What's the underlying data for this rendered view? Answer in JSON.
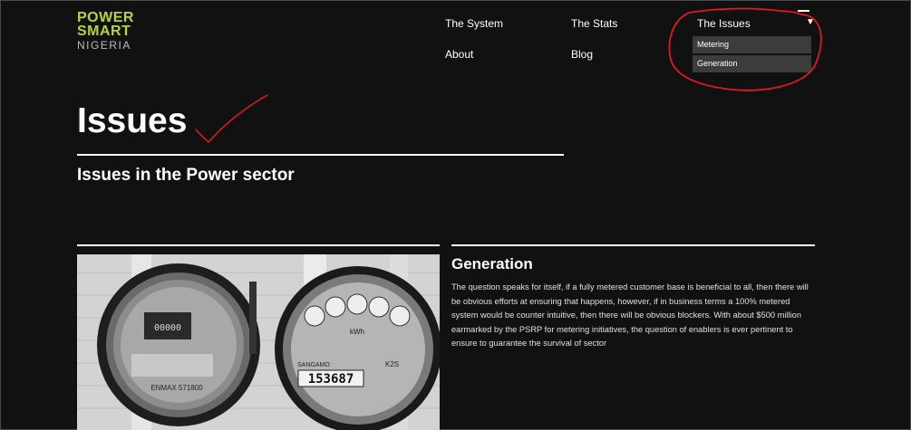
{
  "logo": {
    "line1": "POWER",
    "line2": "SMART",
    "line3": "NIGERIA"
  },
  "nav": {
    "system": "The System",
    "stats": "The Stats",
    "issues": "The Issues",
    "about": "About",
    "blog": "Blog",
    "dropdown_items": [
      "Metering",
      "Generation"
    ]
  },
  "page": {
    "title": "Issues",
    "subtitle": "Issues in the Power sector"
  },
  "photo": {
    "left_meter": {
      "readout": "00000",
      "brand": "ENMAX 571800"
    },
    "right_meter": {
      "brand": "SANGAMO",
      "model": "K2S",
      "reading": "153687"
    }
  },
  "article": {
    "heading": "Generation",
    "body": "The question speaks for itself, if a fully metered customer base is beneficial to all, then there will be obvious efforts at ensuring that happens, however, if in business terms a 100% metered system would be counter intuitive, then there will be obvious blockers. With about $500 million earmarked by the PSRP for metering initiatives, the question of enablers is ever pertinent to ensure to guarantee the survival of sector"
  },
  "colors": {
    "background": "#121112",
    "logo_accent": "#b5d342",
    "annotation": "#e0191e",
    "dropdown_bg": "#3c3c3c"
  },
  "icons": {
    "dropdown": "caret-down-icon"
  }
}
